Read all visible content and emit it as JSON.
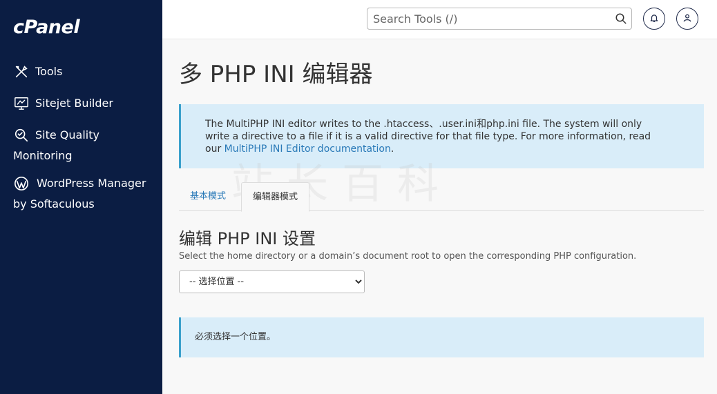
{
  "sidebar": {
    "logo": "cPanel",
    "items": [
      {
        "label": "Tools",
        "icon": "tools-icon"
      },
      {
        "label": "Sitejet Builder",
        "icon": "monitor-icon"
      },
      {
        "label": "Site Quality",
        "label2": "Monitoring",
        "icon": "search-quality-icon"
      },
      {
        "label": "WordPress Manager",
        "label2": "by Softaculous",
        "icon": "wordpress-icon"
      }
    ]
  },
  "header": {
    "search_placeholder": "Search Tools (/)"
  },
  "main": {
    "title": "多 PHP INI 编辑器",
    "info_text": "The MultiPHP INI editor writes to the .htaccess、.user.ini和php.ini file. The system will only write a directive to a file if it is a valid directive for that file type. For more information, read our ",
    "info_link": "MultiPHP INI Editor documentation",
    "info_end": ".",
    "tabs": [
      {
        "label": "基本模式",
        "active": false
      },
      {
        "label": "编辑器模式",
        "active": true
      }
    ],
    "section_title": "编辑 PHP INI 设置",
    "section_desc": "Select the home directory or a domain’s document root to open the corresponding PHP configuration.",
    "select_value": "-- 选择位置 --",
    "notice": "必须选择一个位置。"
  },
  "watermark_text": "站长百科",
  "colors": {
    "sidebar_bg": "#0b1d43",
    "info_bg": "#d9edf9",
    "info_border": "#3aa0cb",
    "link": "#2a7ab8"
  }
}
